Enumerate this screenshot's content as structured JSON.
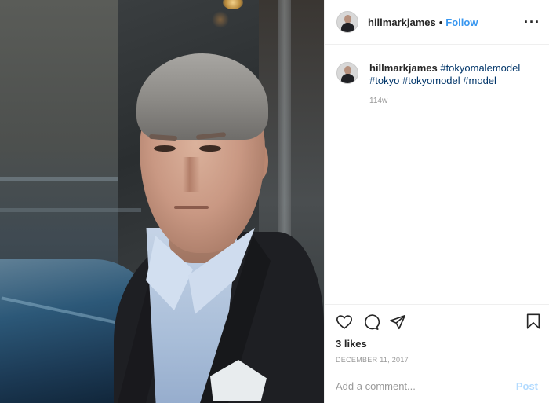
{
  "post": {
    "username": "hillmarkjames",
    "separator": "•",
    "follow_label": "Follow",
    "more_label": "···"
  },
  "caption": {
    "username": "hillmarkjames",
    "hashtags": [
      "#tokyomalemodel",
      "#tokyo",
      "#tokyomodel",
      "#model"
    ],
    "time_ago": "114w"
  },
  "actions": {
    "icons": [
      "heart-icon",
      "comment-icon",
      "share-icon",
      "bookmark-icon"
    ],
    "likes": "3 likes",
    "date": "DECEMBER 11, 2017"
  },
  "comment": {
    "placeholder": "Add a comment...",
    "post_label": "Post"
  },
  "colors": {
    "link": "#3897f0",
    "hashtag": "#003569",
    "muted": "#999999",
    "post_disabled": "#b3dbff"
  }
}
